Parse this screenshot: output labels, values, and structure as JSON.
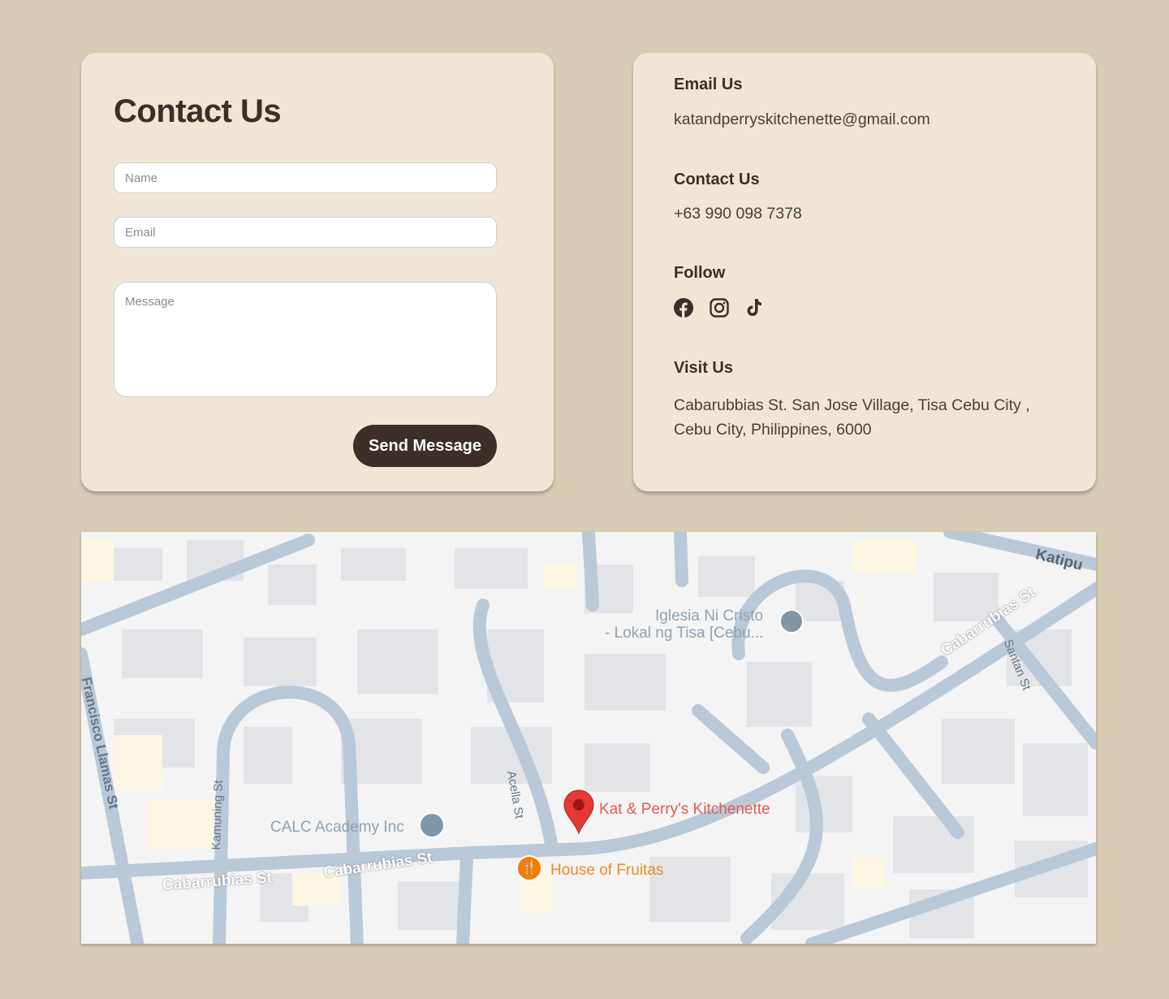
{
  "form": {
    "title": "Contact Us",
    "name_placeholder": "Name",
    "email_placeholder": "Email",
    "message_placeholder": "Message",
    "send_label": "Send Message"
  },
  "info": {
    "email_heading": "Email Us",
    "email": "katandperryskitchenette@gmail.com",
    "contact_heading": "Contact Us",
    "phone": "+63 990 098 7378",
    "follow_heading": "Follow",
    "socials": [
      "facebook-icon",
      "instagram-icon",
      "tiktok-icon"
    ],
    "visit_heading": "Visit Us",
    "address_line1": "Cabarubbias St. San Jose Village, Tisa Cebu City ,",
    "address_line2": "Cebu City, Philippines, 6000"
  },
  "map": {
    "pin_label": "Kat & Perry's Kitchenette",
    "poi_fruitas": "House of Fruitas",
    "poi_calc": "CALC Academy Inc",
    "poi_iglesia_1": "Iglesia Ni Cristo",
    "poi_iglesia_2": "- Lokal ng Tisa [Cebu...",
    "street_cabarrubias": "Cabarrubias St",
    "street_katipunan": "Katipu",
    "street_santan": "Santan St",
    "street_acella": "Acella St",
    "street_kamuning": "Kamuning St",
    "street_llamas": "Francisco Llamas St",
    "colors": {
      "road": "#b9c9d8",
      "building": "#e3e4e8",
      "pin": "#e53935",
      "food": "#f57c00"
    }
  }
}
